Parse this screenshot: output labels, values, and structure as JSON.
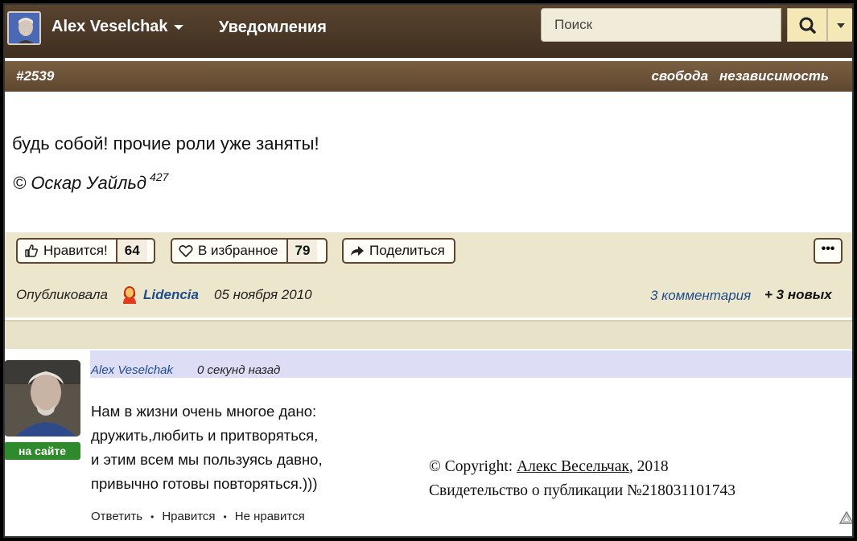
{
  "nav": {
    "user_name": "Alex Veselchak",
    "notifications": "Уведомления",
    "search_placeholder": "Поиск"
  },
  "post": {
    "id": "#2539",
    "tags": [
      "свобода",
      "независимость"
    ],
    "quote": "будь собой! прочие роли уже заняты!",
    "author": "© Оскар Уайльд",
    "author_count": "427",
    "actions": {
      "like_label": "Нравится!",
      "like_count": "64",
      "fav_label": "В избранное",
      "fav_count": "79",
      "share_label": "Поделиться",
      "more_label": "•••"
    },
    "meta": {
      "published_by": "Опубликовала",
      "publisher": "Lidencia",
      "date": "05 ноября 2010",
      "comments": "3 комментария",
      "new_comments": "+ 3 новых"
    }
  },
  "comment": {
    "user": "Alex Veselchak",
    "time": "0 секунд назад",
    "status": "на сайте",
    "lines": [
      "Нам в жизни очень многое дано:",
      "дружить,любить и притворяться,",
      "и этим всем мы пользуясь давно,",
      "привычно готовы повторяться.)))"
    ],
    "actions": {
      "reply": "Ответить",
      "like": "Нравится",
      "dislike": "Не нравится",
      "bullet": "•"
    }
  },
  "copyright": {
    "prefix": "© Copyright: ",
    "author": "Алекс Весельчак",
    "year": ", 2018",
    "certificate": "Свидетельство о публикации №218031101743"
  }
}
